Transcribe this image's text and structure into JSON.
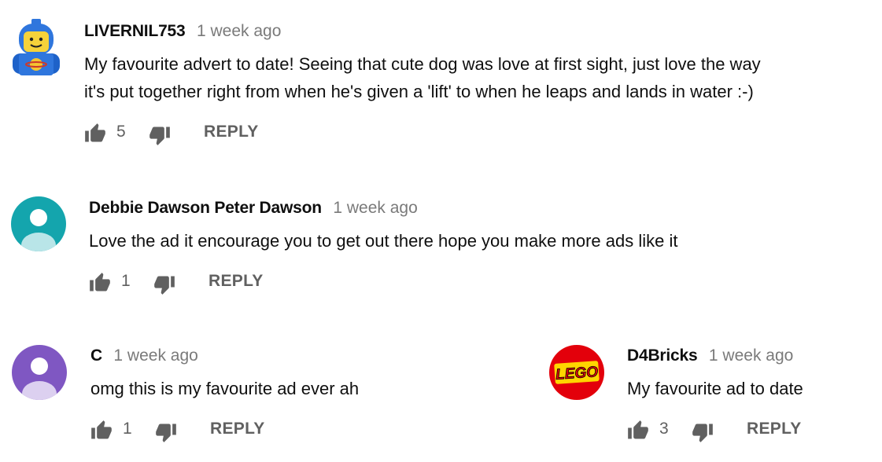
{
  "comments": [
    {
      "author": "LIVERNIL753",
      "time": "1 week ago",
      "text_lines": [
        "My favourite advert to date! Seeing that cute dog was love at first sight, just love the way",
        "it's put together right from when he's given a 'lift' to when he leaps and lands in water :-)"
      ],
      "likes": "5",
      "reply_label": "REPLY",
      "avatar_icon": "lego-astronaut-avatar"
    },
    {
      "author": "Debbie Dawson Peter Dawson",
      "time": "1 week ago",
      "text_lines": [
        "Love the ad it encourage you to get out there hope you make more ads like it"
      ],
      "likes": "1",
      "reply_label": "REPLY",
      "avatar_icon": "default-user-avatar",
      "avatar_color": "#14a5ad"
    },
    {
      "author": "C",
      "time": "1 week ago",
      "text_lines": [
        "omg this is my favourite ad ever ah"
      ],
      "likes": "1",
      "reply_label": "REPLY",
      "avatar_icon": "default-user-avatar",
      "avatar_color": "#7f57c2"
    },
    {
      "author": "D4Bricks",
      "time": "1 week ago",
      "text_lines": [
        "My favourite ad to date"
      ],
      "likes": "3",
      "reply_label": "REPLY",
      "avatar_icon": "lego-logo-avatar",
      "avatar_logo_text": "LEGO"
    }
  ],
  "colors": {
    "author": "#0f0f0f",
    "time": "#7a7a7a",
    "actions": "#606060",
    "lego_red": "#e3000b"
  }
}
